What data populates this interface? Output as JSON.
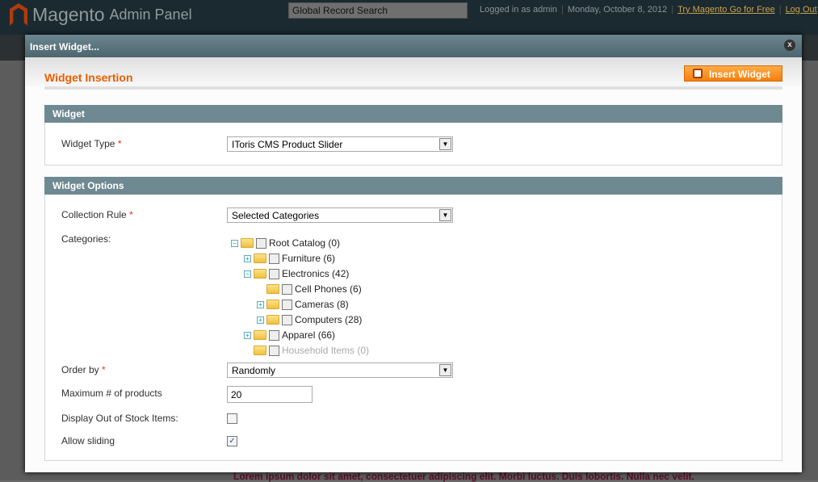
{
  "header": {
    "logo": "Magento",
    "logo_sub": "Admin Panel",
    "search_placeholder": "Global Record Search",
    "logged_in": "Logged in as admin",
    "date": "Monday, October 8, 2012",
    "try_link": "Try Magento Go for Free",
    "logout": "Log Out"
  },
  "background": {
    "lorem": "Lorem ipsum dolor sit amet, consectetuer adipiscing elit. Morbi luctus. Duis lobortis. Nulla nec velit."
  },
  "modal": {
    "title": "Insert Widget...",
    "close": "x",
    "heading": "Widget Insertion",
    "insert_button": "Insert Widget",
    "widget_section": {
      "title": "Widget",
      "type_label": "Widget Type",
      "type_value": "IToris CMS Product Slider"
    },
    "options_section": {
      "title": "Widget Options",
      "collection_label": "Collection Rule",
      "collection_value": "Selected Categories",
      "categories_label": "Categories:",
      "tree": [
        {
          "label": "Root Catalog (0)",
          "level": 0,
          "expander": "minus",
          "checked": false,
          "disabled": false
        },
        {
          "label": "Furniture (6)",
          "level": 1,
          "expander": "plus",
          "checked": false,
          "disabled": false
        },
        {
          "label": "Electronics (42)",
          "level": 1,
          "expander": "minus",
          "checked": false,
          "disabled": false
        },
        {
          "label": "Cell Phones (6)",
          "level": 2,
          "expander": "none",
          "checked": false,
          "disabled": false
        },
        {
          "label": "Cameras (8)",
          "level": 2,
          "expander": "plus",
          "checked": false,
          "disabled": false
        },
        {
          "label": "Computers (28)",
          "level": 2,
          "expander": "plus",
          "checked": false,
          "disabled": false
        },
        {
          "label": "Apparel (66)",
          "level": 1,
          "expander": "plus",
          "checked": false,
          "disabled": false
        },
        {
          "label": "Household Items (0)",
          "level": 1,
          "expander": "none",
          "checked": false,
          "disabled": true
        }
      ],
      "order_label": "Order by",
      "order_value": "Randomly",
      "max_label": "Maximum # of products",
      "max_value": "20",
      "oos_label": "Display Out of Stock Items:",
      "oos_checked": false,
      "sliding_label": "Allow sliding",
      "sliding_checked": true
    }
  },
  "required_mark": "*"
}
